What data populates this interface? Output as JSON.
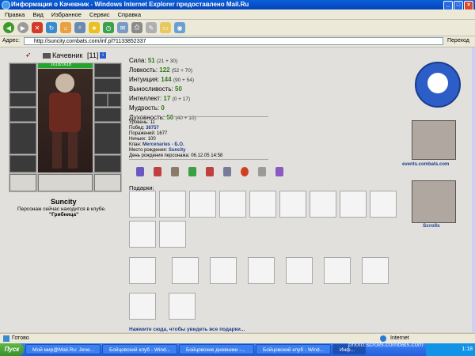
{
  "window": {
    "title": "Информация о Качевник - Windows Internet Explorer предоставлено Mail.Ru"
  },
  "menu": [
    "Правка",
    "Вид",
    "Избранное",
    "Сервис",
    "Справка"
  ],
  "address": {
    "label": "Адрес:",
    "url": "http://suncity.combats.com/inf.pl?1133852337",
    "go_label": "Переход"
  },
  "character": {
    "name": "Качевник",
    "level": "[11]",
    "hp": "1618/1618",
    "city": "Suncity",
    "location_text": "Персонаж сейчас находится в клубе.",
    "location_room": "\"Грибница\""
  },
  "stats": [
    {
      "label": "Сила:",
      "value": "51",
      "extra": "(21 + 30)"
    },
    {
      "label": "Ловкость:",
      "value": "122",
      "extra": "(52 + 70)"
    },
    {
      "label": "Интуиция:",
      "value": "144",
      "extra": "(90 + 54)"
    },
    {
      "label": "Выносливость:",
      "value": "50",
      "extra": ""
    },
    {
      "label": "Интеллект:",
      "value": "17",
      "extra": "(0 + 17)"
    },
    {
      "label": "Мудрость:",
      "value": "0",
      "extra": ""
    },
    {
      "label": "Духовность:",
      "value": "50",
      "extra": "(40 + 10)"
    }
  ],
  "info": [
    {
      "label": "Уровень:",
      "value": "11"
    },
    {
      "label": "Побед:",
      "value": "38757"
    },
    {
      "label": "Поражений:",
      "value": "1677"
    },
    {
      "label": "Ничьих:",
      "value": "100"
    },
    {
      "label": "Клан:",
      "value": "Mercenaries - Б.О."
    },
    {
      "label": "Место рождения:",
      "value": "Suncity"
    },
    {
      "label": "День рождения персонажа:",
      "value": "06.12.05 14:58"
    }
  ],
  "gifts": {
    "label": "Подарки:",
    "more_link": "Нажмите сюда, чтобы увидеть все подарки..."
  },
  "sidebar": {
    "events_label": "events.combats.com",
    "scrolls_label": "Scrolls"
  },
  "status": {
    "text": "Готово",
    "zone": "Internet"
  },
  "taskbar": {
    "start": "Пуск",
    "tasks": [
      "Мой мир@Mail.Ru: Jene...",
      "Бойцовский клуб - Wind...",
      "Бойцовские дневники -...",
      "Бойцовский клуб - Wind...",
      "Инф..."
    ],
    "clock": "1:18",
    "watermark": "photo.scrolls.combats.com"
  }
}
